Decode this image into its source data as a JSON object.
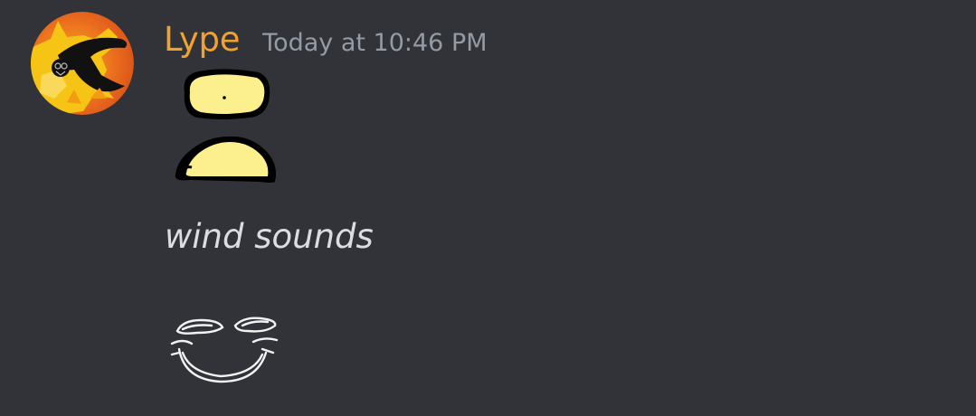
{
  "message": {
    "author": "Lype",
    "timestamp": "Today at 10:46 PM",
    "text": "wind sounds",
    "author_color": "#f0a132",
    "timestamp_color": "#949ba4",
    "text_color": "#dbdee1",
    "background_color": "#313338"
  },
  "avatar": {
    "icon": "fox-avatar-icon"
  },
  "drawings": [
    {
      "icon": "yellow-eye-drawing-icon"
    },
    {
      "icon": "yellow-mouth-drawing-icon"
    },
    {
      "icon": "smile-face-doodle-icon"
    }
  ]
}
